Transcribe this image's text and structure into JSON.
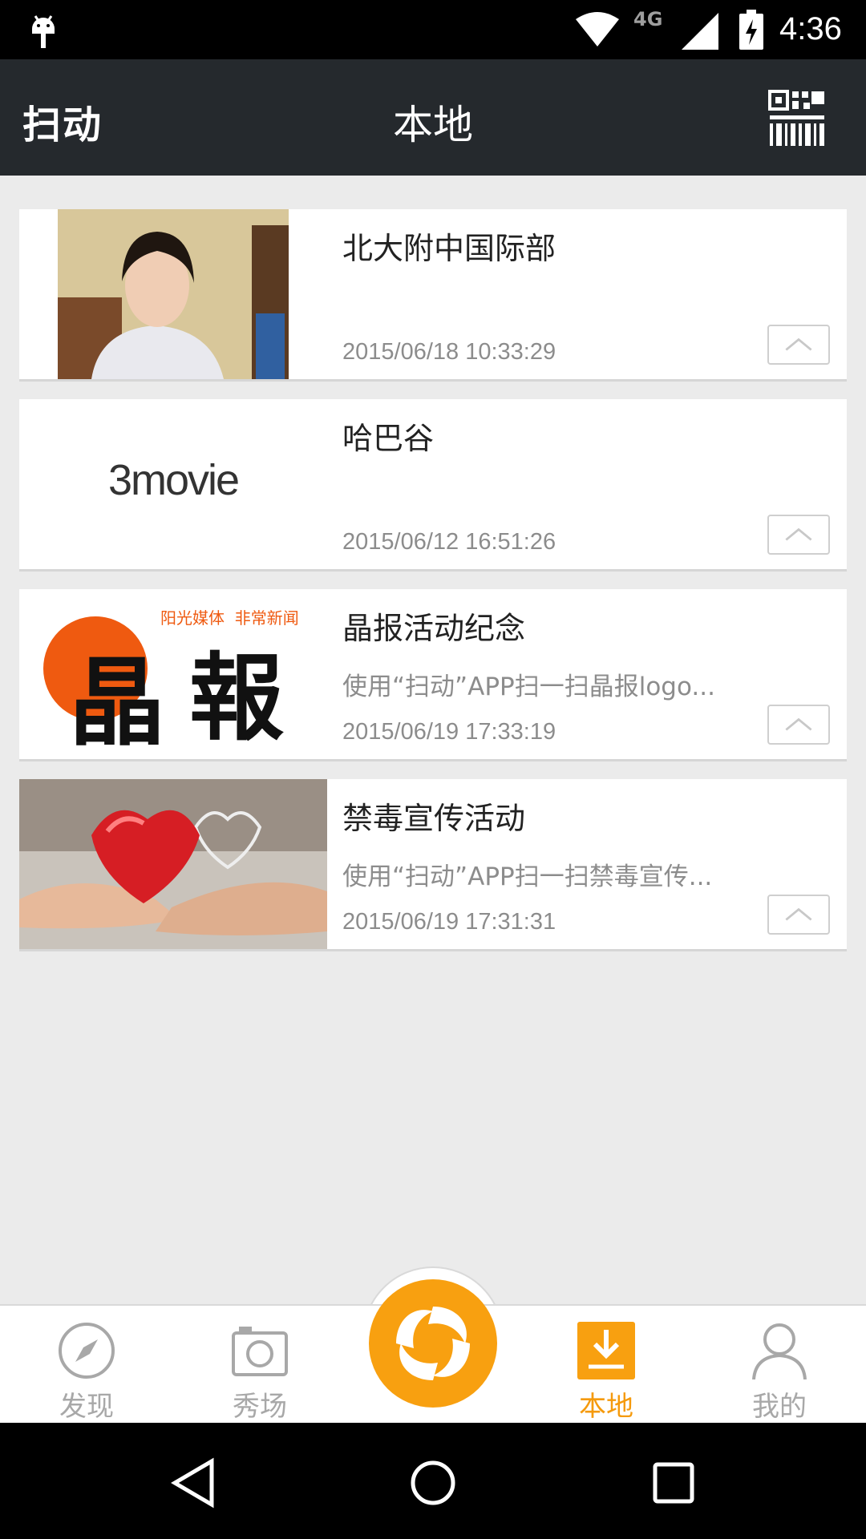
{
  "status_bar": {
    "network": "4G",
    "time": "4:36"
  },
  "app_bar": {
    "brand": "扫动",
    "title": "本地",
    "qr_icon": "qr-barcode-icon"
  },
  "items": [
    {
      "title": "北大附中国际部",
      "desc": "",
      "time": "2015/06/18 10:33:29",
      "thumb_icon": "portrait-photo"
    },
    {
      "title": "哈巴谷",
      "desc": "",
      "time": "2015/06/12 16:51:26",
      "thumb_text": "3movie"
    },
    {
      "title": "晶报活动纪念",
      "desc": "使用“扫动”APP扫一扫晶报logo...",
      "time": "2015/06/19 17:33:19",
      "thumb_caption": "阳光媒体  非常新闻",
      "thumb_logo_1": "晶",
      "thumb_logo_2": "報"
    },
    {
      "title": "禁毒宣传活动",
      "desc": "使用“扫动”APP扫一扫禁毒宣传...",
      "time": "2015/06/19 17:31:31",
      "thumb_icon": "heart-hands-photo"
    }
  ],
  "bottom_nav": [
    {
      "label": "发现",
      "icon": "compass-icon"
    },
    {
      "label": "秀场",
      "icon": "camera-icon"
    },
    {
      "label": "本地",
      "icon": "download-icon",
      "active": true
    },
    {
      "label": "我的",
      "icon": "user-icon"
    }
  ],
  "colors": {
    "accent": "#f59a0c",
    "app_bar": "#25292d",
    "background": "#ebebeb"
  }
}
